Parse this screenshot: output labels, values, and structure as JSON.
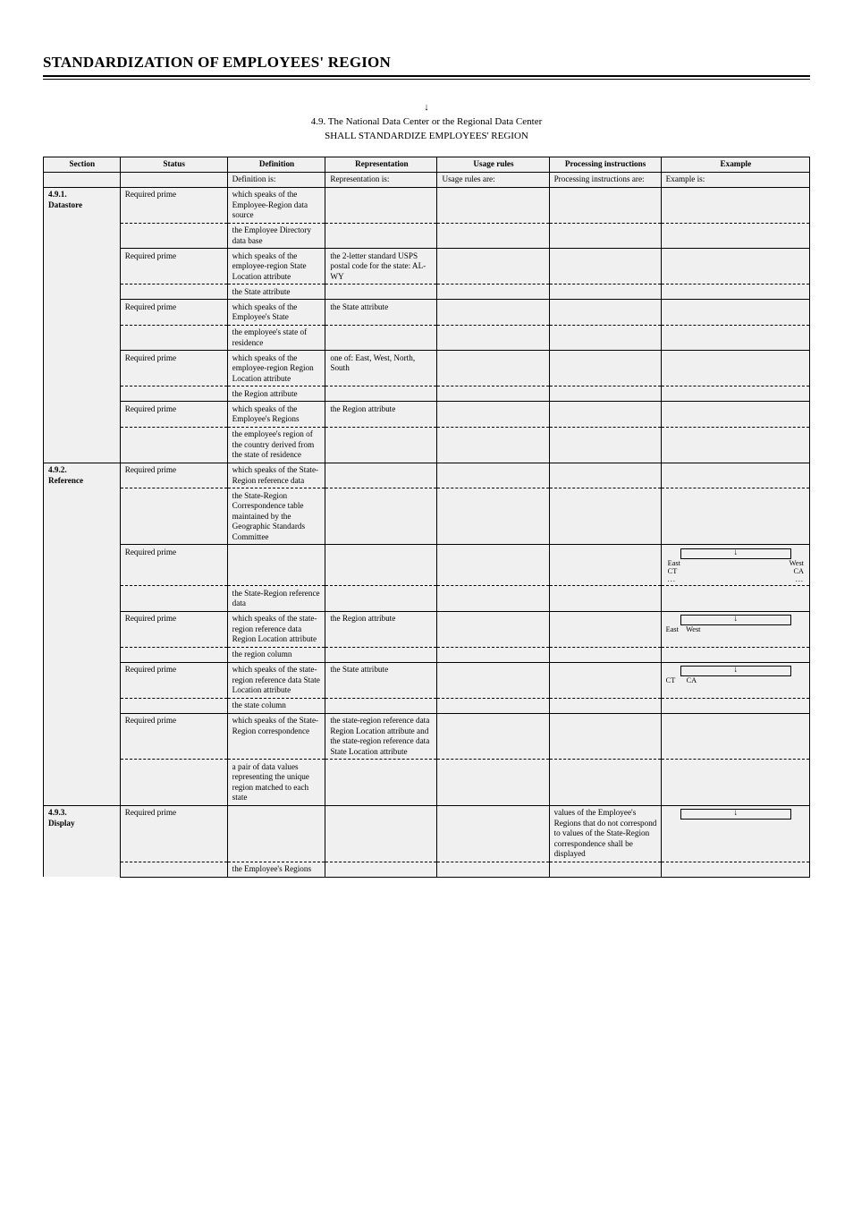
{
  "header": {
    "title": "STANDARDIZATION OF EMPLOYEES' REGION"
  },
  "table": {
    "title_line1": "↓",
    "title_line2": "4.9. The National Data Center or the Regional Data Center",
    "title_line3": "SHALL STANDARDIZE EMPLOYEES' REGION",
    "columns": {
      "c1": "Section",
      "c2": "Status",
      "c3": "Definition",
      "c4": "Representation",
      "c5": "Usage rules",
      "c6": "Processing instructions",
      "c7": "Example"
    },
    "header2": {
      "c3": "Definition is:",
      "c4": "Representation is:",
      "c5": "Usage rules are:",
      "c6": "Processing instructions are:",
      "c7": "Example is:"
    },
    "rows": [
      {
        "section": "4.9.1.",
        "section_extra": "Datastore",
        "items": [
          {
            "status": "Required prime",
            "def_label": "the Employee-Region data source",
            "def": "the Employee Directory data base",
            "rep": "",
            "use": "",
            "proc": "",
            "ex": ""
          },
          {
            "status": "Required prime",
            "def_label": "the employee-region State Location attribute",
            "def": "the State attribute",
            "rep": "the 2-letter standard USPS postal code for the state: AL-WY",
            "use": "",
            "proc": "",
            "ex": ""
          },
          {
            "status": "Required prime",
            "def_label": "the Employee's State",
            "def": "the employee's state of residence",
            "rep": "the State attribute",
            "use": "",
            "proc": "",
            "ex": ""
          },
          {
            "status": "Required prime",
            "def_label": "the employee-region Region Location attribute",
            "def": "the Region attribute",
            "rep": "one of: East, West, North, South",
            "use": "",
            "proc": "",
            "ex": ""
          },
          {
            "status": "Required prime",
            "def_label": "the Employee's Regions",
            "def": "the employee's region of the country derived from the state of residence",
            "rep": "the Region attribute",
            "use": "",
            "proc": "",
            "ex": ""
          }
        ]
      },
      {
        "section": "4.9.2.",
        "section_extra": "Reference",
        "items": [
          {
            "status": "Required prime",
            "def_label": "the State-Region reference data",
            "def": "the State-Region Correspondence table maintained by the Geographic Standards Committee",
            "rep": "",
            "use": "",
            "proc": "",
            "ex": ""
          },
          {
            "status": "Required prime",
            "def_label": "",
            "def": "the State-Region reference data",
            "rep": "",
            "use": "",
            "proc": "",
            "ex_arrow": true,
            "ex_table": {
              "a1": "East",
              "a2": "West",
              "b1": "CT",
              "b2": "CA",
              "c1": "...",
              "c2": "..."
            }
          },
          {
            "status": "Required prime",
            "def_label": "the state-region reference data Region Location attribute",
            "def": "the region column",
            "rep": "the Region attribute",
            "use": "",
            "proc": "",
            "ex_arrow": true,
            "ex_region": "East    West"
          },
          {
            "status": "Required prime",
            "def_label": "the state-region reference data State Location attribute",
            "def": "the state column",
            "rep": "the State attribute",
            "use": "",
            "proc": "",
            "ex_arrow": true,
            "ex_region": "CT      CA"
          },
          {
            "status": "Required prime",
            "def_label": "the State-Region correspondence",
            "def": "a pair of data values representing the unique region matched to each state",
            "rep": "the state-region reference data Region Location attribute and the state-region reference data State Location attribute",
            "use": "",
            "proc": "",
            "ex": ""
          }
        ]
      },
      {
        "section": "4.9.3.",
        "section_extra": "Display",
        "items": [
          {
            "status": "Required prime",
            "def_label": "",
            "def": "the Employee's Regions",
            "rep": "",
            "use": "",
            "proc": "values of the Employee's Regions that do not correspond to values of the State-Region correspondence shall be displayed",
            "ex_arrow": true,
            "ex": ""
          }
        ]
      }
    ]
  }
}
